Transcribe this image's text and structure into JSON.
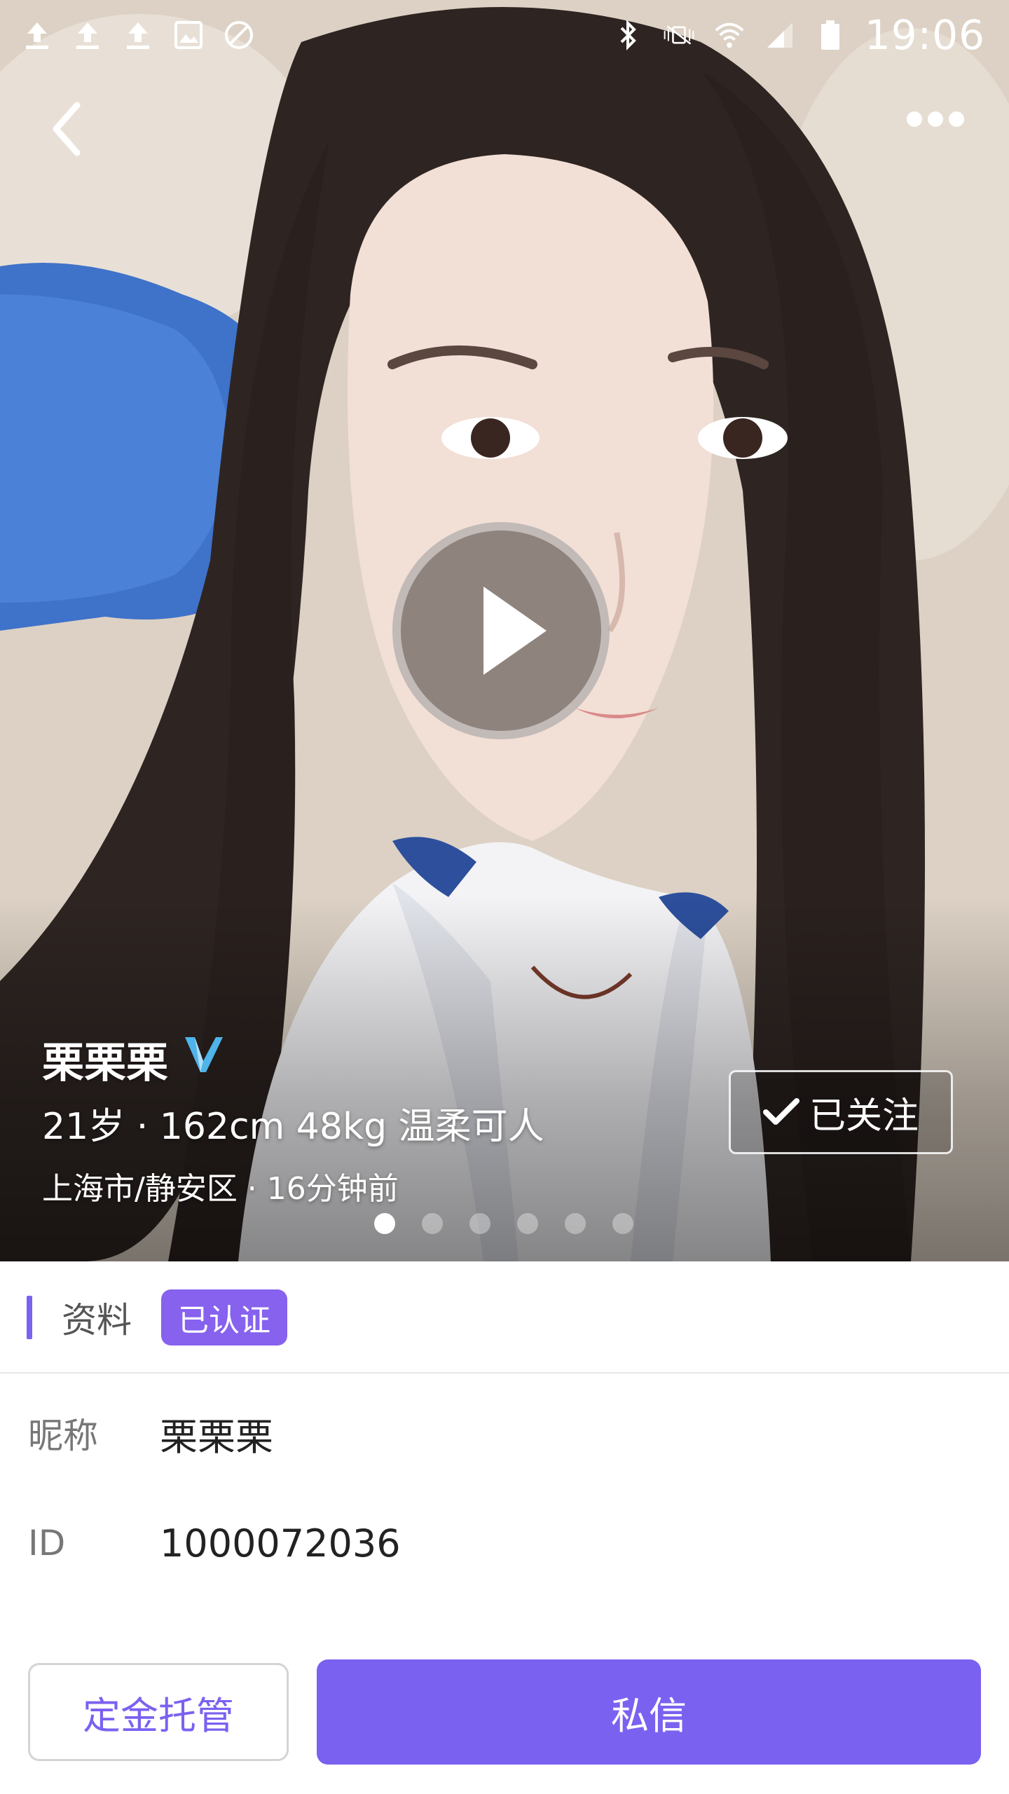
{
  "status_bar": {
    "time": "19:06",
    "left_icons": [
      "upload-icon",
      "upload-icon",
      "upload-icon",
      "image-icon",
      "blocked-icon"
    ],
    "right_icons": [
      "bluetooth-icon",
      "vibrate-mute-icon",
      "wifi-icon",
      "signal-icon",
      "battery-icon"
    ]
  },
  "profile": {
    "name": "栗栗栗",
    "stats": "21岁 · 162cm 48kg 温柔可人",
    "location": "上海市/静安区 · 16分钟前",
    "follow_label": "已关注"
  },
  "gallery": {
    "page_count": 6,
    "active_index": 0
  },
  "info": {
    "section_title": "资料",
    "verified_label": "已认证",
    "rows": [
      {
        "label": "昵称",
        "value": "栗栗栗"
      },
      {
        "label": "ID",
        "value": "1000072036"
      }
    ]
  },
  "actions": {
    "deposit_label": "定金托管",
    "message_label": "私信"
  },
  "colors": {
    "accent": "#7b61f0",
    "badge": "#8662ee",
    "verified_check": "#4fb4ea"
  }
}
